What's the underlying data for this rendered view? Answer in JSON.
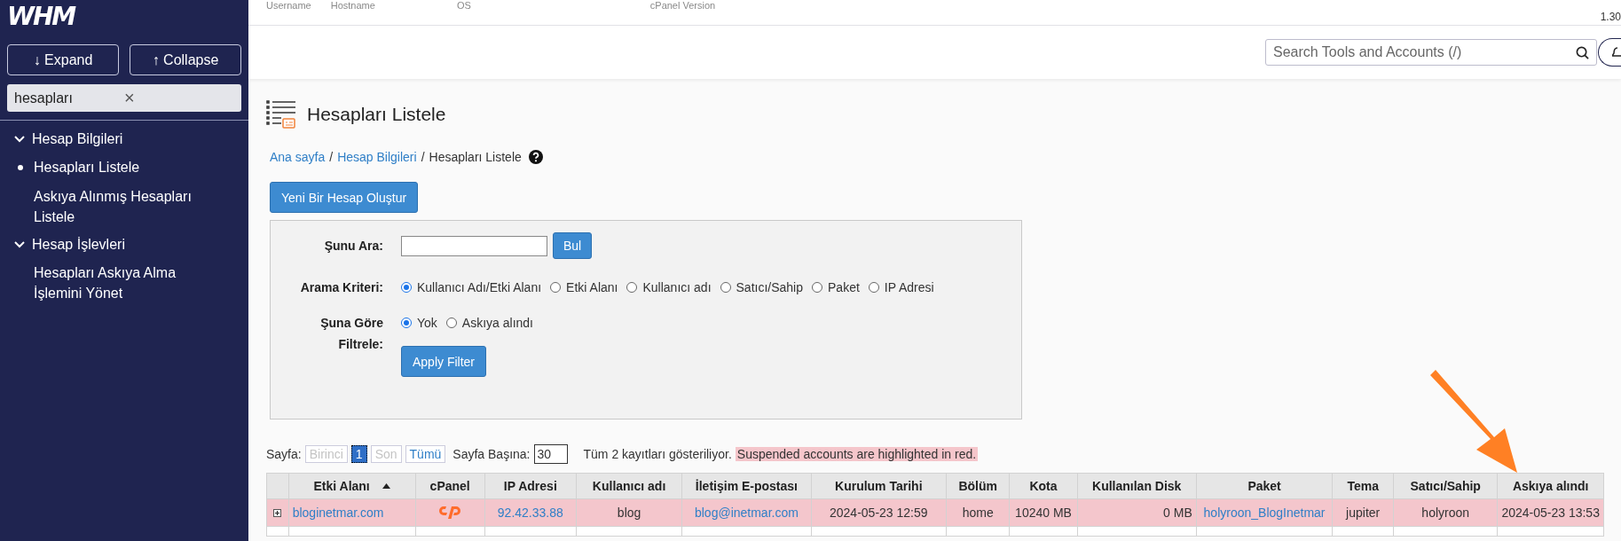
{
  "top_info": {
    "labels": [
      "Username",
      "Hostname",
      "OS",
      "cPanel Version"
    ],
    "version": "1.30"
  },
  "sidebar": {
    "logo": "WHM",
    "buttons": [
      {
        "icon": "↓",
        "label": "Expand"
      },
      {
        "icon": "↑",
        "label": "Collapse"
      }
    ],
    "search": {
      "value": "hesapları",
      "clear": "×"
    },
    "groups": [
      {
        "label": "Hesap Bilgileri",
        "expanded": true,
        "items": [
          {
            "label": "Hesapları Listele",
            "selected": true
          },
          {
            "label": "Askıya Alınmış Hesapları Listele",
            "selected": false
          }
        ]
      },
      {
        "label": "Hesap İşlevleri",
        "expanded": true,
        "items": [
          {
            "label": "Hesapları Askıya Alma İşlemini Yönet",
            "selected": false
          }
        ]
      }
    ]
  },
  "header": {
    "search": {
      "placeholder": "Search Tools and Accounts (/)"
    }
  },
  "page": {
    "title": "Hesapları Listele",
    "breadcrumb": [
      {
        "label": "Ana sayfa",
        "kind": "link",
        "separator": "/"
      },
      {
        "label": "Hesap Bilgileri",
        "kind": "link",
        "separator": "/"
      },
      {
        "label": "Hesapları Listele",
        "kind": "current"
      }
    ],
    "create_button": "Yeni Bir Hesap Oluştur"
  },
  "form": {
    "search_label": "Şunu Ara:",
    "find_button": "Bul",
    "criteria_label": "Arama Kriteri:",
    "criteria": [
      {
        "label": "Kullanıcı Adı/Etki Alanı",
        "selected": true
      },
      {
        "label": "Etki Alanı",
        "selected": false
      },
      {
        "label": "Kullanıcı adı",
        "selected": false
      },
      {
        "label": "Satıcı/Sahip",
        "selected": false
      },
      {
        "label": "Paket",
        "selected": false
      },
      {
        "label": "IP Adresi",
        "selected": false
      }
    ],
    "filter_label": "Şuna Göre Filtrele:",
    "filters": [
      {
        "label": "Yok",
        "selected": true
      },
      {
        "label": "Askıya alındı",
        "selected": false
      }
    ],
    "apply_button": "Apply Filter"
  },
  "pagination": {
    "label": "Sayfa:",
    "pages": [
      {
        "label": "Birinci",
        "selected": false,
        "disabled": true
      },
      {
        "label": "1",
        "selected": true,
        "disabled": false
      },
      {
        "label": "Son",
        "selected": false,
        "disabled": true
      },
      {
        "label": "Tümü",
        "selected": false,
        "disabled": false
      }
    ],
    "per_page_label": "Sayfa Başına:",
    "per_page": "30",
    "summary": "Tüm 2 kayıtları gösteriliyor.",
    "notice": "Suspended accounts are highlighted in red."
  },
  "table": {
    "columns": [
      {
        "label": "Etki Alanı",
        "sorted": true
      },
      {
        "label": "cPanel",
        "sorted": false
      },
      {
        "label": "IP Adresi",
        "sorted": false
      },
      {
        "label": "Kullanıcı adı",
        "sorted": false
      },
      {
        "label": "İletişim E-postası",
        "sorted": false
      },
      {
        "label": "Kurulum Tarihi",
        "sorted": false
      },
      {
        "label": "Bölüm",
        "sorted": false
      },
      {
        "label": "Kota",
        "sorted": false
      },
      {
        "label": "Kullanılan Disk",
        "sorted": false
      },
      {
        "label": "Paket",
        "sorted": false
      },
      {
        "label": "Tema",
        "sorted": false
      },
      {
        "label": "Satıcı/Sahip",
        "sorted": false
      },
      {
        "label": "Askıya alındı",
        "sorted": false
      }
    ],
    "rows": [
      {
        "suspended": true,
        "cells": [
          {
            "kind": "link",
            "text": "bloginetmar.com"
          },
          {
            "kind": "cpanel"
          },
          {
            "kind": "link",
            "text": "92.42.33.88"
          },
          {
            "kind": "text",
            "text": "blog"
          },
          {
            "kind": "link",
            "text": "blog@inetmar.com"
          },
          {
            "kind": "text",
            "text": "2024-05-23 12:59"
          },
          {
            "kind": "text",
            "text": "home"
          },
          {
            "kind": "text",
            "text": "10240 MB"
          },
          {
            "kind": "text",
            "text": "0 MB"
          },
          {
            "kind": "link",
            "text": "holyroon_BlogInetmar"
          },
          {
            "kind": "text",
            "text": "jupiter"
          },
          {
            "kind": "text",
            "text": "holyroon"
          },
          {
            "kind": "text",
            "text": "2024-05-23 13:53"
          }
        ]
      }
    ]
  }
}
